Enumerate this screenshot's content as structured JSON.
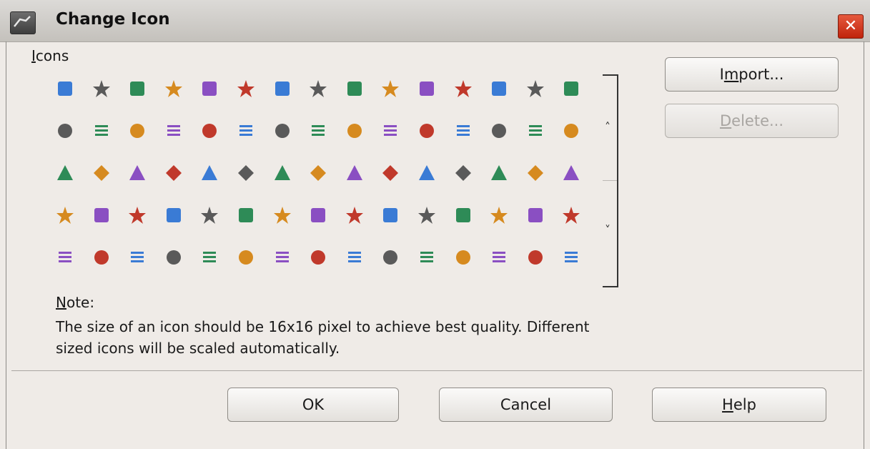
{
  "dialog": {
    "title": "Change Icon",
    "close_glyph": "✕"
  },
  "icons_section": {
    "label_underlined": "I",
    "label_rest": "cons",
    "icons": [
      [
        "macro-scroll",
        "text-field",
        "autospellcheck",
        "oval-shape",
        "puzzle",
        "table-grid",
        "sort-az",
        "spelling-abc",
        "arrow-right",
        "align-justify",
        "align-left",
        "frame",
        "star-four",
        "square-blue",
        "user-edit"
      ],
      [
        "star",
        "button",
        "star-burst",
        "calendar",
        "gear-star",
        "x-box",
        "slant-line",
        "stamp",
        "abc-accent",
        "arrow-up",
        "col-split",
        "insert-field",
        "form-grid",
        "grid-small",
        "magic-wand"
      ],
      [
        "rounded-rect",
        "double-button",
        "cross-blue",
        "swap-arrows",
        "minus-bar",
        "floppy-disk",
        "doc-list",
        "rounded-outline",
        "triangle-down",
        "callout",
        "chevron-down-shape",
        "zoom-page",
        "pointer",
        "currency-percent",
        "bracket"
      ],
      [
        "form-doc",
        "play-star",
        "stepper",
        "play-box",
        "diamond",
        "merge-arrows",
        "align-center",
        "undo",
        "image-landscape",
        "pin-flag",
        "arrow-down-outline",
        "arc-curve",
        "list-box",
        "redo-arrow",
        "find-user"
      ],
      [
        "text-doc",
        "folder-tab",
        "cut-doc",
        "triangle-filled",
        "spiral",
        "edit-folder",
        "pdf-export",
        "pencil",
        "ole-object",
        "underline",
        "triangle-outline",
        "square-split",
        "burst-dots",
        "table-yellow",
        "form-design"
      ]
    ]
  },
  "buttons": {
    "import": {
      "before": "I",
      "underlined": "m",
      "after": "port..."
    },
    "delete": {
      "before": "",
      "underlined": "D",
      "after": "elete..."
    },
    "ok": "OK",
    "cancel": "Cancel",
    "help": {
      "before": "",
      "underlined": "H",
      "after": "elp"
    }
  },
  "note": {
    "title_underlined": "N",
    "title_rest": "ote:",
    "text_line1": "The size of an icon should be 16x16 pixel to achieve best quality. Different",
    "text_line2": "sized icons will be scaled automatically."
  },
  "scroll": {
    "up": "˄",
    "down": "˅"
  },
  "colors": {
    "accent_blue": "#3a7bd5",
    "close_red": "#d0341a"
  }
}
